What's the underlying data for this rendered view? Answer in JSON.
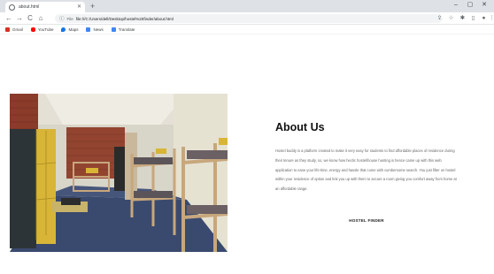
{
  "browser": {
    "tab_title": "about.html",
    "tab_close_glyph": "✕",
    "new_tab_glyph": "+",
    "window_controls": {
      "minimize": "–",
      "restore": "▢",
      "close": "✕"
    },
    "nav": {
      "back": "←",
      "forward": "→",
      "reload": "C",
      "home": "⌂"
    },
    "address_info_glyph": "ⓘ",
    "address_scheme_label": "File",
    "address_url": "file:///C:/Users/dell/Desktop/hostel%20finder/about.html",
    "toolbar_icons": [
      "share-icon",
      "star-icon",
      "extensions-icon",
      "sidebar-icon",
      "profile-icon",
      "menu-icon"
    ],
    "bookmarks": [
      {
        "label": "Gmail",
        "icon": "gmail-icon",
        "color": "#d93025"
      },
      {
        "label": "YouTube",
        "icon": "youtube-icon",
        "color": "#ff0000"
      },
      {
        "label": "Maps",
        "icon": "maps-icon",
        "color": "#1a73e8"
      },
      {
        "label": "News",
        "icon": "news-icon",
        "color": "#4285f4"
      },
      {
        "label": "Translate",
        "icon": "translate-icon",
        "color": "#4285f4"
      }
    ]
  },
  "about": {
    "title": "About Us",
    "paragraph": "Hostel buddy is a platform created to make it very easy for students to find affordable places of residence during their tenure as they study, so, we know how hectic hostel/house hunting is hence came up with this web application to ease your life-time, energy and hassle that come with cumbersome search. You just filter on hostel within your residence of option and link you up with them to secure a room giving you comfort away from home at an affordable range.",
    "signature": "HOSTEL FINDER"
  },
  "hero_image": {
    "subject": "hostel dormitory room with wooden bunk beds and yellow lockers",
    "colors": {
      "ceiling": "#e4e0d6",
      "floor": "#3a4a6e",
      "brick": "#8b3b2a",
      "wood": "#c7a77c",
      "locker": "#d8b536",
      "wall": "#d8d5c9"
    }
  }
}
